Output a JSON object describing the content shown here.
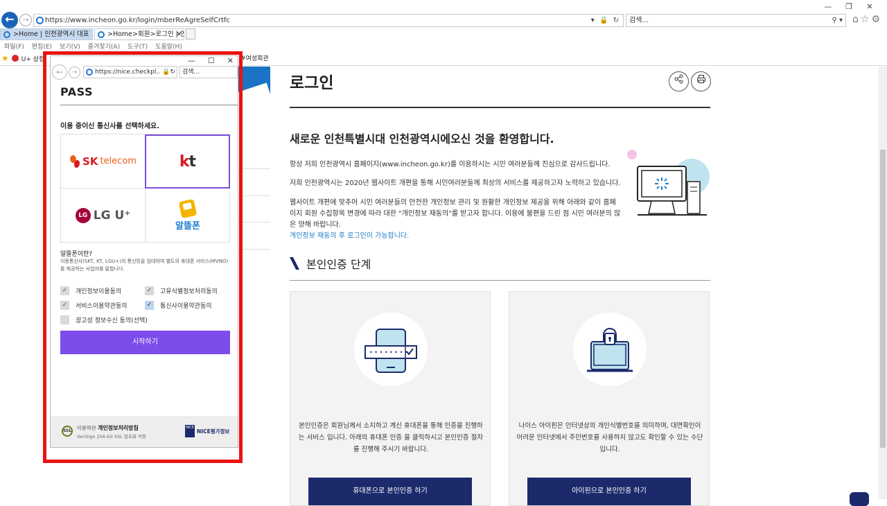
{
  "browser": {
    "url": "https://www.incheon.go.kr/login/mberReAgreSelfCrtfc",
    "search_placeholder": "검색...",
    "tabs": [
      {
        "label": ">Home | 인천광역시 대표"
      },
      {
        "label": ">Home>회원>로그인 | 인..."
      }
    ],
    "menu": [
      "파일(F)",
      "편집(E)",
      "보기(V)",
      "즐겨찾기(A)",
      "도구(T)",
      "도움말(H)"
    ],
    "favorites": [
      "U+ 상점"
    ],
    "favorites_extra": "#여성회관"
  },
  "page": {
    "title": "로그인",
    "welcome": "새로운 인천특별시대 인천광역시에오신 것을 환영합니다.",
    "paragraphs": [
      "항상 저희 인천광역시 홈페이지(www.incheon.go.kr)를 이용하시는 시민 여러분들께 진심으로 감사드립니다.",
      "저희 인천광역시는 2020년 웹사이트 개편을 통해 시민여러분들께 최상의 서비스를 제공하고자 노력하고 있습니다.",
      "웹사이트 개편에 맞추어 시민 여러분들의 안전한 개인정보 관리 및 원활한 개인정보 제공을 위해 아래와 같이 홈페이지 회원 수집항목 변경에 따라 대한 \"개인정보 재동의\"를 받고자 합니다. 이용에 불편을 드린 점 시민 여러분의 많은 양해 바랍니다."
    ],
    "link_text": "개인정보 재동의 후 로그인이 가능합니다.",
    "step_heading": "본인인증 단계",
    "cards": [
      {
        "text": "본인인증은 회원님께서 소지하고 계신 휴대폰을 통해 인증을 진행하는 서비스 입니다. 아래의 휴대폰 인증 을 클릭하시고 본인인증 절차를 진행해 주시기 바랍니다.",
        "button": "휴대폰으로 본인인증 하기"
      },
      {
        "text": "나이스 아이핀은 인터넷상의 개인식별번호를 의미하며, 대면확인이 어려운 인터넷에서 주민번호를 사용하지 않고도 확인할 수 있는 수단입니다.",
        "button": "아이핀으로 본인인증 하기"
      }
    ]
  },
  "popup": {
    "url": "https://nice.checkpl...",
    "search_placeholder": "검색...",
    "brand": "PASS",
    "question": "이용 중이신 통신사를 선택하세요.",
    "carriers": [
      {
        "name": "SK telecom",
        "brand_a": "SK",
        "brand_b": "telecom"
      },
      {
        "name": "kt",
        "brand_a": "k",
        "brand_b": "t"
      },
      {
        "name": "LG U+",
        "brand_a": "LG",
        "brand_b": "LG U⁺"
      },
      {
        "name": "알뜰폰"
      }
    ],
    "selected_carrier": "kt",
    "info_title": "알뜰폰이란?",
    "info_text": "이동통신사(SKT, KT, LGU+)의 통신망을 임대하여 별도의 휴대폰 서비스(MVNO)를 제공하는 사업자를 말합니다.",
    "agreements": [
      {
        "label": "개인정보이용동의",
        "checked": true
      },
      {
        "label": "고유식별정보처리동의",
        "checked": true
      },
      {
        "label": "서비스이용약관동의",
        "checked": true
      },
      {
        "label": "통신사이용약관동의",
        "checked": true
      },
      {
        "label": "광고성 정보수신 동의(선택)",
        "checked": false
      }
    ],
    "start_button": "시작하기",
    "footer": {
      "seal": "SSL",
      "terms": "이용약관",
      "privacy": "개인정보처리방침",
      "ssl_note": "VeriSign 256-bit SSL 암호화 적용",
      "nice_mark": "NICE",
      "nice_label": "NICE평가정보"
    }
  },
  "colors": {
    "accent_purple": "#7c4dea",
    "navy": "#1c2a6b",
    "frame_red": "#ea1212",
    "link_blue": "#1e7fc8"
  }
}
